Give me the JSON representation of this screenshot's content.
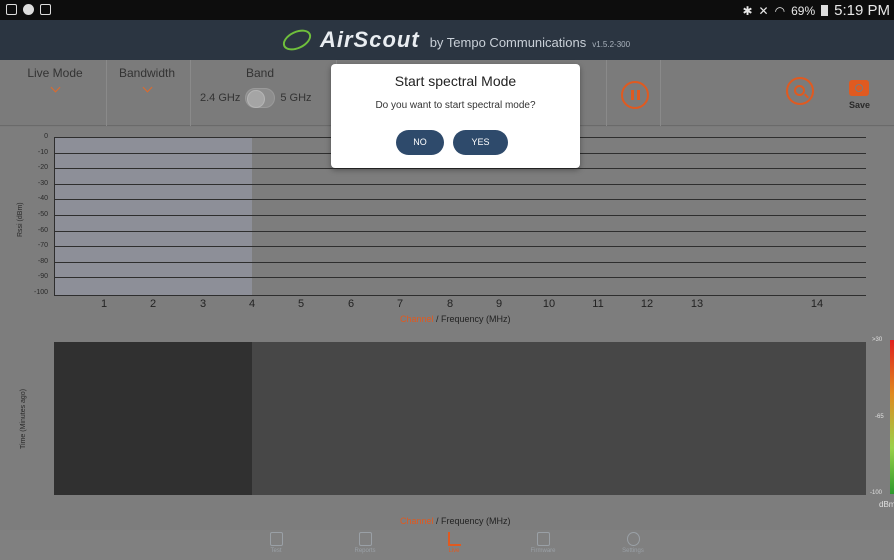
{
  "statusbar": {
    "battery": "69%",
    "time": "5:19 PM"
  },
  "app": {
    "name": "AirScout",
    "by": "by Tempo Communications",
    "version": "v1.5.2-300"
  },
  "toolbar": {
    "live_mode": "Live Mode",
    "bandwidth": "Bandwidth",
    "band": "Band",
    "band_low": "2.4 GHz",
    "band_high": "5 GHz",
    "save": "Save"
  },
  "spectrum": {
    "y_label": "Rssi (dBm)",
    "y_ticks": [
      "0",
      "-10",
      "-20",
      "-30",
      "-40",
      "-50",
      "-60",
      "-70",
      "-80",
      "-90",
      "-100"
    ],
    "x_ticks": [
      "1",
      "2",
      "3",
      "4",
      "5",
      "6",
      "7",
      "8",
      "9",
      "10",
      "11",
      "12",
      "13",
      "14"
    ],
    "x_label_channel": "Channel",
    "x_label_rest": " / Frequency (MHz)"
  },
  "waterfall": {
    "y_label": "Time (Minutes ago)",
    "x_label_channel": "Channel",
    "x_label_rest": " / Frequency (MHz)",
    "legend_top": ">30",
    "legend_mid": "-65",
    "legend_bottom": "-100",
    "legend_unit": "dBm"
  },
  "nav": [
    {
      "label": "Test",
      "icon": "test-icon"
    },
    {
      "label": "Reports",
      "icon": "reports-icon"
    },
    {
      "label": "Live",
      "icon": "live-chart-icon",
      "active": true
    },
    {
      "label": "Firmware",
      "icon": "firmware-icon"
    },
    {
      "label": "Settings",
      "icon": "settings-icon"
    }
  ],
  "dialog": {
    "title": "Start spectral Mode",
    "message": "Do you want to start spectral mode?",
    "no": "NO",
    "yes": "YES"
  },
  "colors": {
    "accent": "#e05a20",
    "brand_green": "#6fbf3c",
    "title_bar": "#2b3541",
    "dialog_button": "#2e4a6b"
  }
}
